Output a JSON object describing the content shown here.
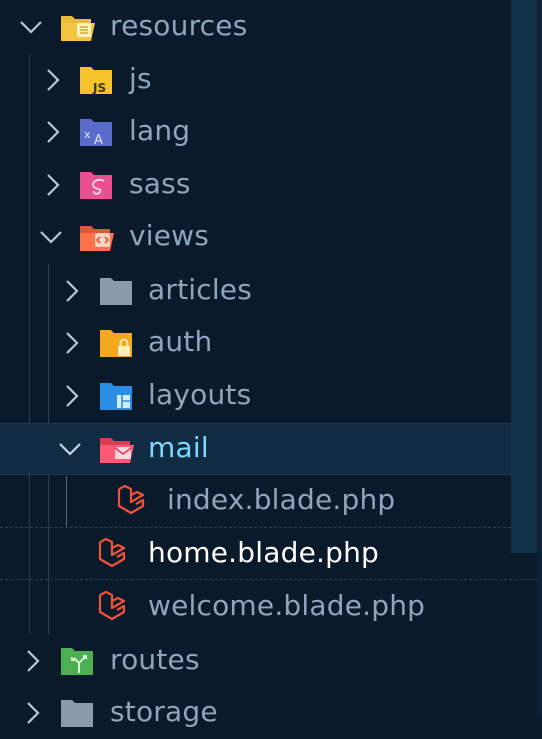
{
  "explorer": {
    "items": [
      {
        "label": "resources",
        "icon": "folder-resources-open-icon"
      },
      {
        "label": "js",
        "icon": "folder-js-icon"
      },
      {
        "label": "lang",
        "icon": "folder-lang-icon"
      },
      {
        "label": "sass",
        "icon": "folder-sass-icon"
      },
      {
        "label": "views",
        "icon": "folder-views-open-icon"
      },
      {
        "label": "articles",
        "icon": "folder-icon"
      },
      {
        "label": "auth",
        "icon": "folder-auth-icon"
      },
      {
        "label": "layouts",
        "icon": "folder-layouts-icon"
      },
      {
        "label": "mail",
        "icon": "folder-mail-open-icon"
      },
      {
        "label": "index.blade.php",
        "icon": "laravel-blade-icon"
      },
      {
        "label": "home.blade.php",
        "icon": "laravel-blade-icon"
      },
      {
        "label": "welcome.blade.php",
        "icon": "laravel-blade-icon"
      },
      {
        "label": "routes",
        "icon": "folder-routes-icon"
      },
      {
        "label": "storage",
        "icon": "folder-icon"
      }
    ]
  },
  "colors": {
    "background": "#0b1a2a",
    "selected_row": "#102b42",
    "label_default": "#8fa4bd",
    "label_active": "#7ed9ff",
    "blade": "#f0533a"
  }
}
